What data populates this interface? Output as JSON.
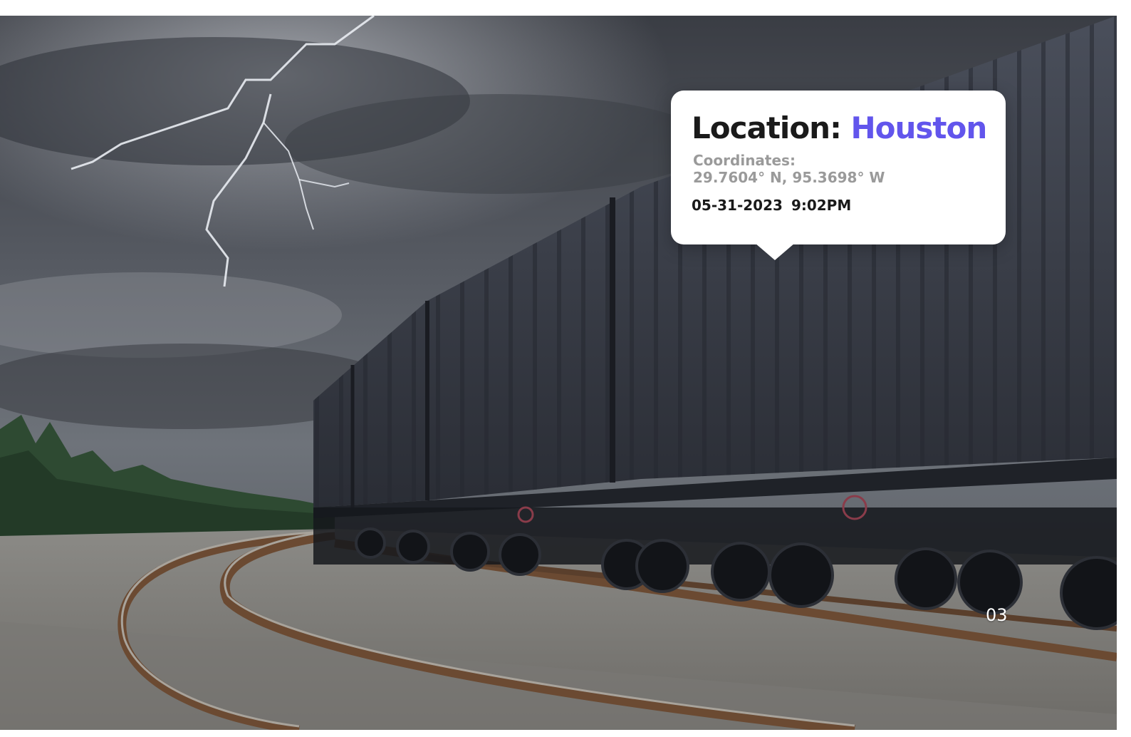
{
  "popup": {
    "title_prefix": "Location:",
    "city": "Houston",
    "coordinates_label": "Coordinates:",
    "coordinates_value": "29.7604° N, 95.3698° W",
    "date": "05-31-2023",
    "time": "9:02PM"
  },
  "page_number": "03",
  "colors": {
    "accent": "#6255ec",
    "title": "#1a1a1a",
    "muted": "#9a9a9a"
  }
}
